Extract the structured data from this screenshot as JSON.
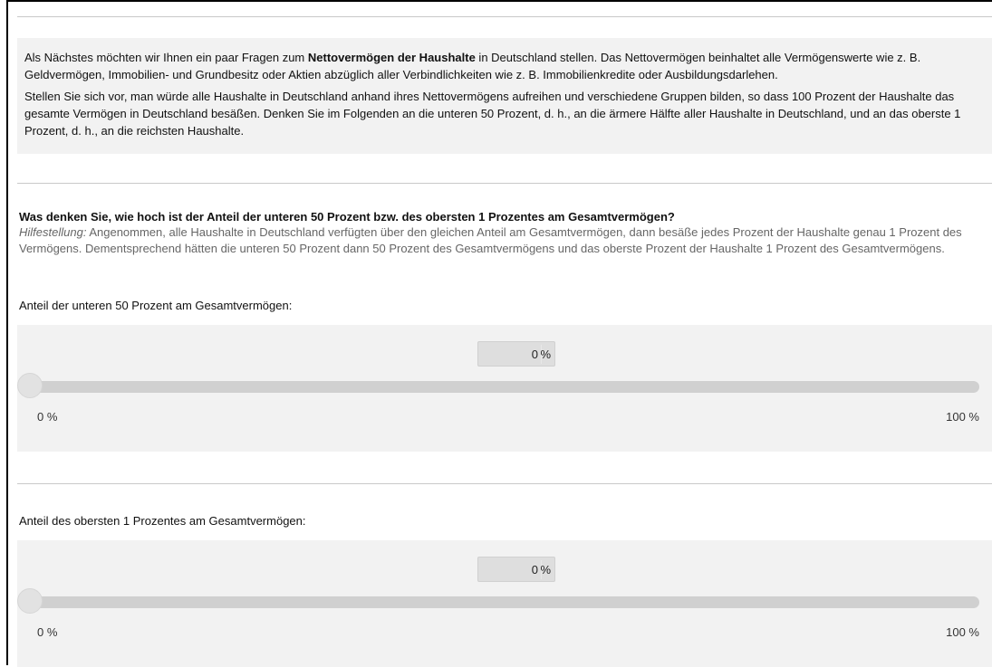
{
  "intro": {
    "p1_before": "Als Nächstes möchten wir Ihnen ein paar Fragen zum ",
    "p1_bold": "Nettovermögen der Haushalte",
    "p1_after": " in Deutschland stellen. Das Nettovermögen beinhaltet alle Vermögenswerte wie z. B. Geldvermögen, Immobilien- und Grundbesitz oder Aktien abzüglich aller Verbindlichkeiten wie z. B. Immobilienkredite oder Ausbildungsdarlehen.",
    "p2": "Stellen Sie sich vor, man würde alle Haushalte in Deutschland anhand ihres Nettovermögens aufreihen und verschiedene Gruppen bilden, so dass 100 Prozent der Haushalte das gesamte Vermögen in Deutschland besäßen. Denken Sie im Folgenden an die unteren 50 Prozent, d. h., an die ärmere Hälfte aller Haushalte in Deutschland, und an das oberste 1 Prozent, d. h., an die reichsten Haushalte."
  },
  "question": {
    "title": "Was denken Sie, wie hoch ist der Anteil der unteren 50 Prozent bzw. des obersten 1 Prozentes am Gesamtvermögen?",
    "hint_label": "Hilfestellung:",
    "hint_text": " Angenommen, alle Haushalte in Deutschland verfügten über den gleichen Anteil am Gesamtvermögen, dann besäße jedes Prozent der Haushalte genau 1 Prozent des Vermögens. Dementsprechend hätten die unteren 50 Prozent dann 50 Prozent des Gesamtvermögens und das oberste Prozent der Haushalte 1 Prozent des Gesamtvermögens."
  },
  "sliders": [
    {
      "label": "Anteil der unteren 50 Prozent am Gesamtvermögen:",
      "value": "0",
      "value_fraction": 0,
      "unit": "%",
      "min_label": "0 %",
      "max_label": "100 %"
    },
    {
      "label": "Anteil des obersten 1 Prozentes am Gesamtvermögen:",
      "value": "0",
      "value_fraction": 0,
      "unit": "%",
      "min_label": "0 %",
      "max_label": "100 %"
    }
  ]
}
